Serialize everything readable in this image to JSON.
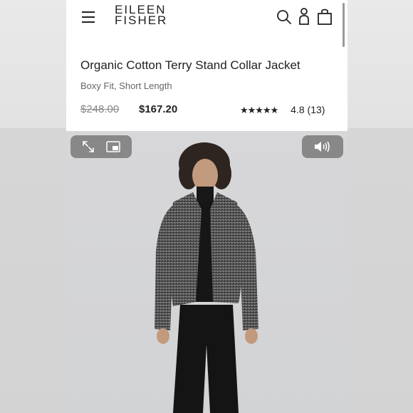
{
  "brand": {
    "line1": "EILEEN",
    "line2": "FISHER"
  },
  "nav": {
    "menu_icon": "hamburger-menu-icon",
    "search_icon": "search-icon",
    "account_icon": "account-icon",
    "bag_icon": "shopping-bag-icon"
  },
  "product": {
    "title": "Organic Cotton Terry Stand Collar Jacket",
    "subtitle": "Boxy Fit, Short Length",
    "price_original": "$248.00",
    "price_sale": "$167.20",
    "stars": "★★★★★",
    "rating": "4.8",
    "review_count": "(13)"
  },
  "media": {
    "expand_icon": "expand-arrows-icon",
    "pip_icon": "picture-in-picture-icon",
    "sound_icon": "speaker-volume-icon"
  },
  "colors": {
    "text": "#222222",
    "muted": "#666666",
    "strike": "#888888",
    "media_bg": "#d4d5d7",
    "control_bg": "#6e6e6e"
  }
}
